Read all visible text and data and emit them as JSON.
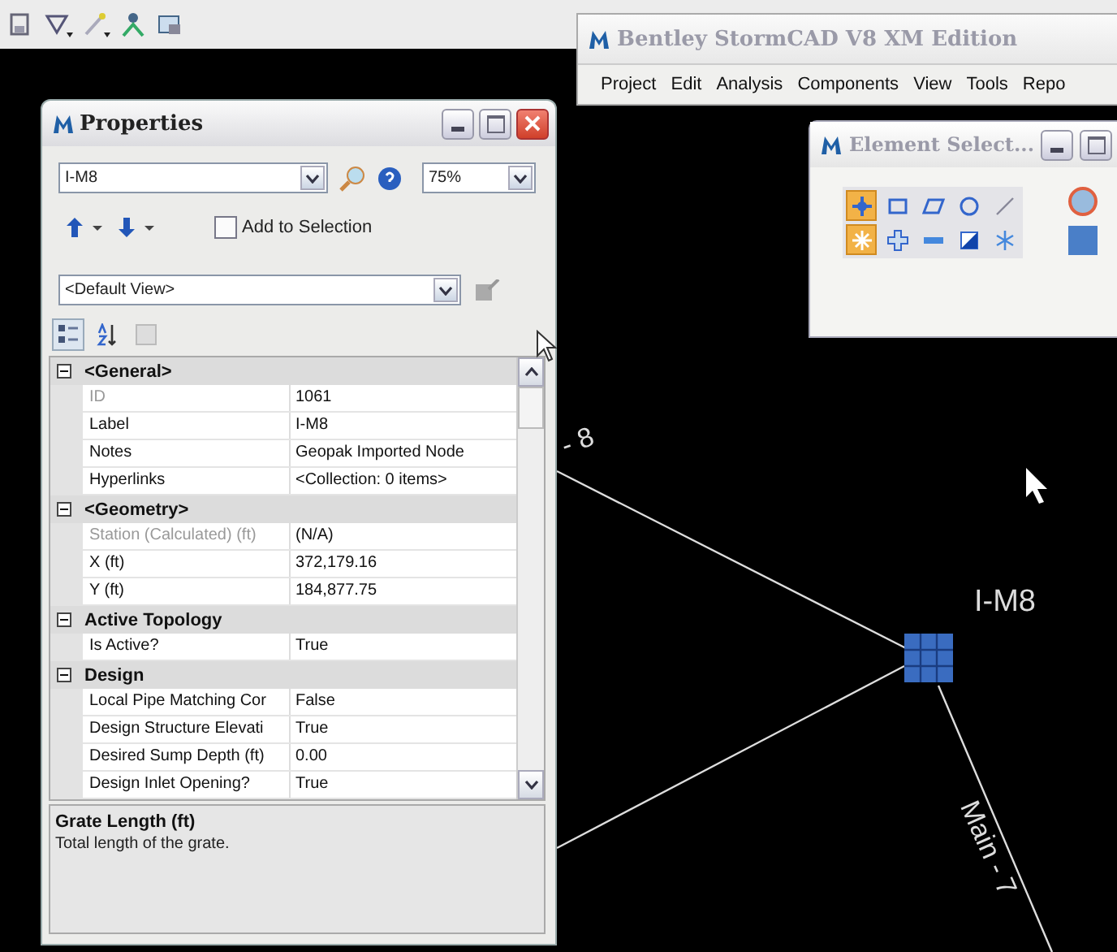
{
  "toolbar": {
    "tools": [
      {
        "kind": "save"
      },
      {
        "kind": "filter",
        "has_menu": true
      },
      {
        "kind": "wand",
        "has_menu": true
      },
      {
        "kind": "people"
      },
      {
        "kind": "window"
      }
    ]
  },
  "main_window": {
    "title": "Bentley StormCAD V8 XM Edition",
    "menu": [
      "Project",
      "Edit",
      "Analysis",
      "Components",
      "View",
      "Tools",
      "Repo"
    ]
  },
  "element_selection": {
    "title": "Element Select...",
    "tools": [
      {
        "kind": "point",
        "selected": true
      },
      {
        "kind": "rectangle",
        "selected": false
      },
      {
        "kind": "parallelogram",
        "selected": false
      },
      {
        "kind": "circle",
        "selected": false
      },
      {
        "kind": "line",
        "selected": false
      },
      {
        "kind": "spark",
        "selected": true
      },
      {
        "kind": "cross",
        "selected": false
      },
      {
        "kind": "dash",
        "selected": false
      },
      {
        "kind": "half-square",
        "selected": false
      },
      {
        "kind": "snowflake",
        "selected": false
      }
    ]
  },
  "properties": {
    "title": "Properties",
    "element_field": {
      "value": "I-M8"
    },
    "zoom_field": {
      "value": "75%"
    },
    "add_to_selection": {
      "label": "Add to Selection",
      "checked": false
    },
    "view_field": {
      "value": "<Default View>"
    },
    "categories": [
      {
        "name": "<General>",
        "expanded": true,
        "rows": [
          {
            "name": "ID",
            "value": "1061",
            "readonly": true
          },
          {
            "name": "Label",
            "value": "I-M8",
            "readonly": false
          },
          {
            "name": "Notes",
            "value": "Geopak Imported Node",
            "readonly": false
          },
          {
            "name": "Hyperlinks",
            "value": "<Collection: 0 items>",
            "readonly": false
          }
        ]
      },
      {
        "name": "<Geometry>",
        "expanded": true,
        "rows": [
          {
            "name": "Station (Calculated) (ft)",
            "value": "(N/A)",
            "readonly": true
          },
          {
            "name": "X (ft)",
            "value": "372,179.16",
            "readonly": false
          },
          {
            "name": "Y (ft)",
            "value": "184,877.75",
            "readonly": false
          }
        ]
      },
      {
        "name": "Active Topology",
        "expanded": true,
        "rows": [
          {
            "name": "Is Active?",
            "value": "True",
            "readonly": false
          }
        ]
      },
      {
        "name": "Design",
        "expanded": true,
        "rows": [
          {
            "name": "Local Pipe Matching Cor",
            "value": "False",
            "readonly": false
          },
          {
            "name": "Design Structure Elevati",
            "value": "True",
            "readonly": false
          },
          {
            "name": "Desired Sump Depth (ft)",
            "value": "0.00",
            "readonly": false
          },
          {
            "name": "Design Inlet Opening?",
            "value": "True",
            "readonly": false
          }
        ]
      }
    ],
    "description": {
      "title": "Grate Length (ft)",
      "text": "Total length of the grate."
    }
  },
  "canvas": {
    "node_label": "I-M8",
    "pipe_labels": [
      "- 8",
      "Main - 7"
    ]
  }
}
